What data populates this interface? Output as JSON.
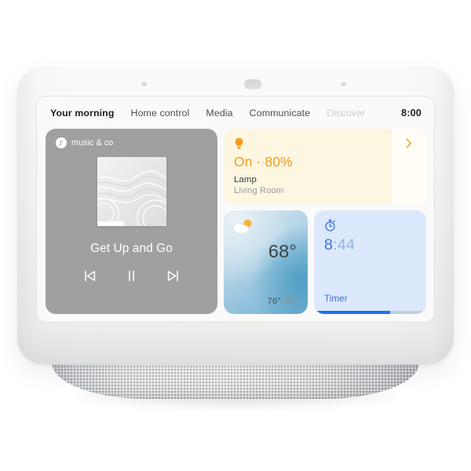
{
  "device": {
    "name": "smart-display",
    "shell_color": "#f6f6f6",
    "speaker_color": "#eceeef",
    "screen_background": "#fafafa"
  },
  "screen": {
    "navbar": {
      "tabs": [
        {
          "label": "Your morning",
          "state": "active"
        },
        {
          "label": "Home control",
          "state": "normal"
        },
        {
          "label": "Media",
          "state": "normal"
        },
        {
          "label": "Communicate",
          "state": "normal"
        },
        {
          "label": "Discover",
          "state": "dim"
        }
      ],
      "clock": "8:00"
    },
    "cards": {
      "media": {
        "provider": "music & co",
        "provider_icon": "music-note-icon",
        "track_title": "Get Up and Go",
        "album_art": "abstract-wave-artwork",
        "controls": [
          {
            "name": "previous-track-button",
            "icon": "skip-previous-icon"
          },
          {
            "name": "pause-button",
            "icon": "pause-icon"
          },
          {
            "name": "next-track-button",
            "icon": "skip-next-icon"
          }
        ],
        "background_color": "#a0a0a0"
      },
      "lamp": {
        "icon": "lightbulb-icon",
        "state": "On · 80%",
        "device_name": "Lamp",
        "room": "Living Room",
        "expand_icon": "chevron-right-icon",
        "accent_color": "#f59b1c",
        "background_color": "#fdf6e0"
      },
      "weather": {
        "icon": "partly-cloudy-icon",
        "temperature": "68°",
        "high": "76°",
        "low": "65°",
        "background_color": "#96c4dd"
      },
      "timer": {
        "icon": "stopwatch-icon",
        "minutes": "8",
        "seconds": ":44",
        "label": "Timer",
        "progress_percent": 68,
        "accent_color": "#1a73e8",
        "background_color": "#dce8fb"
      }
    }
  }
}
